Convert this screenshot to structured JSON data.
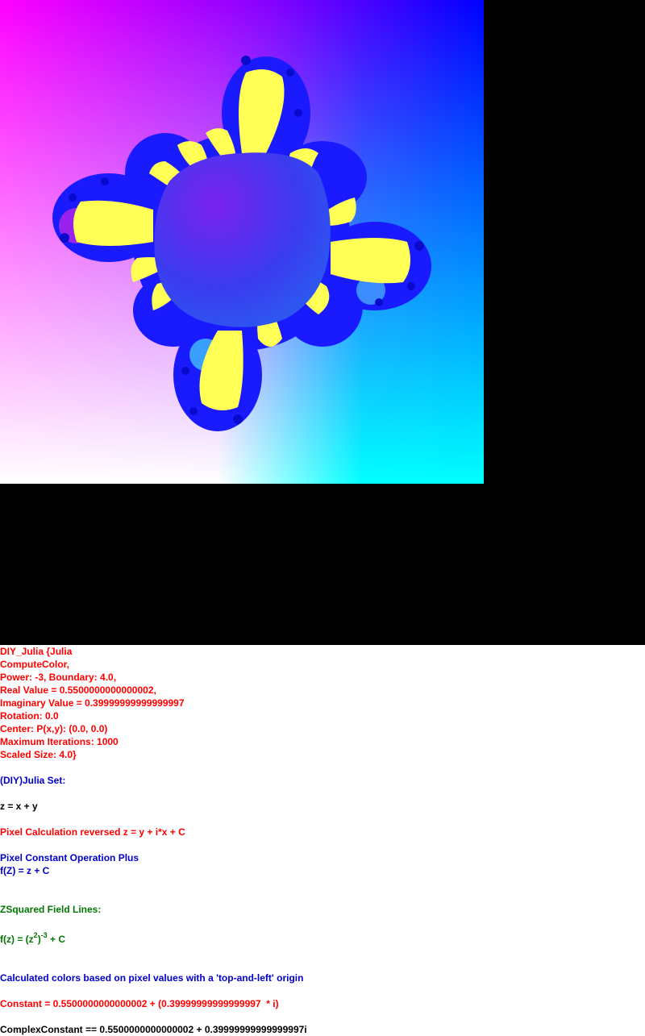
{
  "params": {
    "lines": [
      "DIY_Julia {Julia",
      "ComputeColor,",
      "Power: -3, Boundary: 4.0,",
      "Real Value = 0.5500000000000002,",
      "Imaginary Value = 0.39999999999999997",
      "Rotation: 0.0",
      "Center: P(x,y): (0.0, 0.0)",
      "Maximum Iterations: 1000",
      "Scaled Size: 4.0}"
    ]
  },
  "set_title": "(DIY)Julia Set:",
  "z_def": "z = x + y",
  "pixel_calc": "Pixel Calculation reversed z = y + i*x + C",
  "pixel_op": "Pixel Constant Operation Plus",
  "f_def": "f(Z) = z + C",
  "field_lines": "ZSquared Field Lines:",
  "formula": {
    "prefix": "f(z) = (z",
    "exp_inner": "2",
    "mid": ")",
    "exp_outer": "-3",
    "suffix": " + C"
  },
  "colors_note": "Calculated colors based on pixel values with a 'top-and-left' origin",
  "constant": "Constant = 0.5500000000000002 + (0.39999999999999997  * i)",
  "complex_constant": "ComplexConstant == 0.5500000000000002 + 0.39999999999999997i",
  "palette": {
    "background": "#000000",
    "corner_top_left": "#ff00ff",
    "corner_top_right": "#0000ff",
    "corner_bottom_left": "#ffffff",
    "corner_bottom_right": "#00ffff",
    "petal": "#ffff55",
    "fractal_body": "#1a1aff"
  }
}
